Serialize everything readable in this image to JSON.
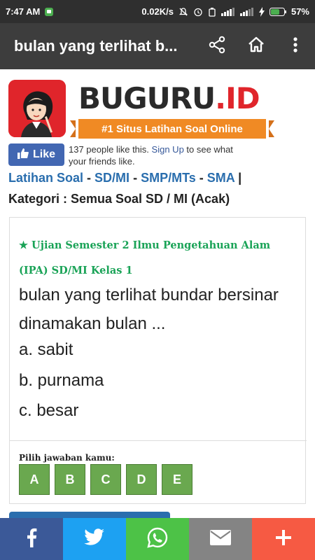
{
  "status_bar": {
    "time": "7:47 AM",
    "speed": "0.02K/s",
    "battery": "57%"
  },
  "app_bar": {
    "title": "bulan yang terlihat b..."
  },
  "brand": {
    "name": "BUGURU",
    "suffix": ".ID",
    "tagline": "#1 Situs Latihan Soal Online",
    "colors": {
      "red": "#e0252b",
      "orange": "#f08a24"
    }
  },
  "facebook": {
    "like_label": "Like",
    "text_before": "137 people like this.",
    "signup_link": "Sign Up",
    "text_after": "to see what your friends like."
  },
  "nav": {
    "links": [
      "Latihan Soal",
      "SD/MI",
      "SMP/MTs",
      "SMA"
    ],
    "separator": "-",
    "end": "|"
  },
  "category": "Kategori : Semua Soal SD / MI (Acak)",
  "question_card": {
    "subject": "★ Ujian Semester 2 Ilmu Pengetahuan Alam (IPA) SD/MI Kelas 1",
    "question": "bulan yang terlihat bundar bersinar dinamakan bulan ...",
    "options": [
      "a. sabit",
      "b. purnama",
      "c. besar"
    ],
    "answer_prompt": "Pilih jawaban kamu:",
    "answer_buttons": [
      "A",
      "B",
      "C",
      "D",
      "E"
    ]
  },
  "share_bar": {
    "buttons": [
      {
        "icon": "facebook-icon",
        "color": "#3b5998"
      },
      {
        "icon": "twitter-icon",
        "color": "#1da1f2"
      },
      {
        "icon": "whatsapp-icon",
        "color": "#4dc247"
      },
      {
        "icon": "email-icon",
        "color": "#848484"
      },
      {
        "icon": "plus-icon",
        "color": "#f65a43"
      }
    ]
  }
}
